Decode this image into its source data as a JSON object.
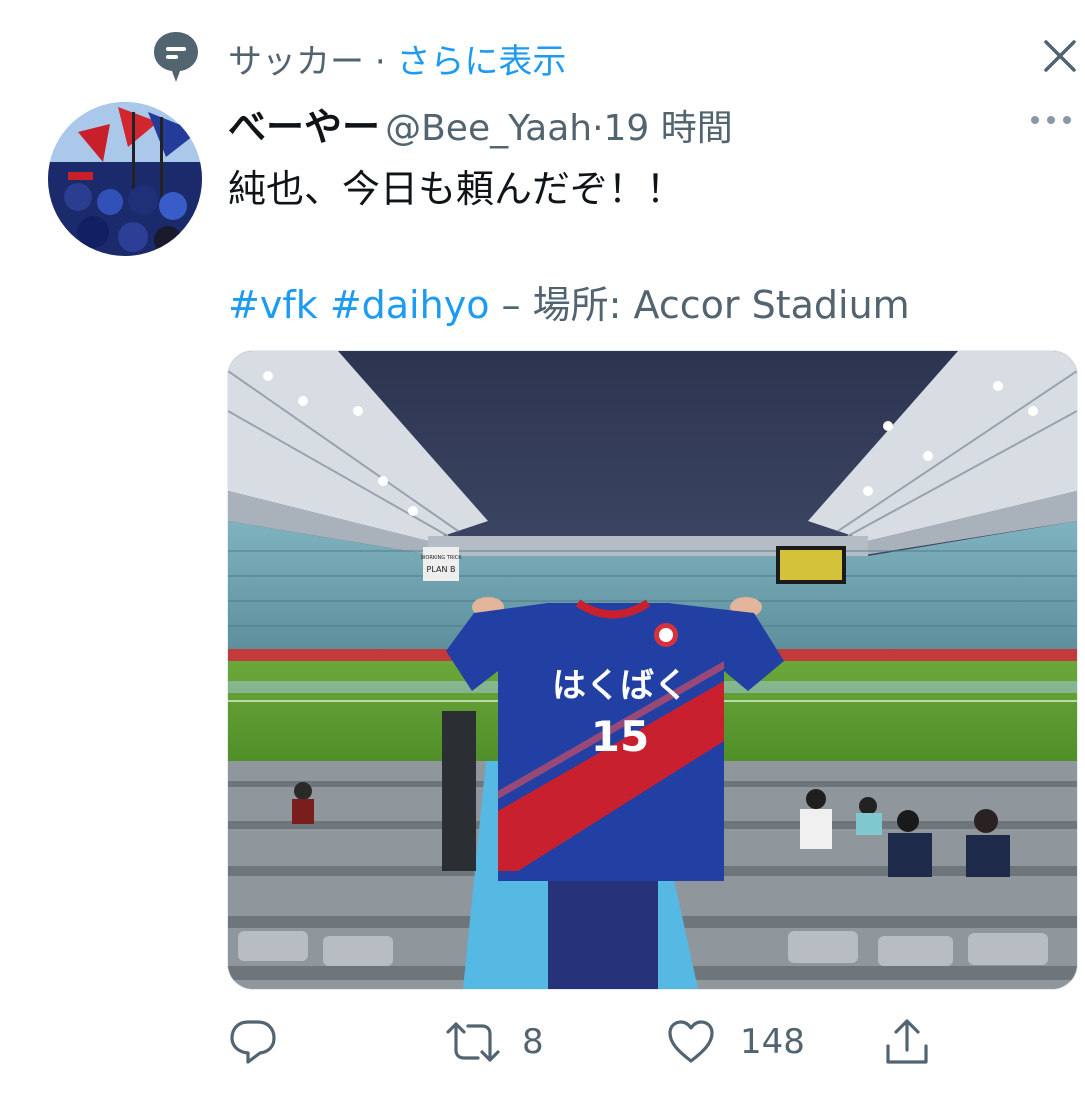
{
  "topic": {
    "label": "サッカー",
    "separator": "·",
    "show_more": "さらに表示"
  },
  "author": {
    "name": "べーやー",
    "handle": "@Bee_Yaah",
    "dot": "·",
    "time": "19 時間"
  },
  "tweet": {
    "text": "純也、今日も頼んだぞ！！",
    "hashtags": [
      "#vfk",
      "#daihyo"
    ],
    "location_prefix": "– 場所: ",
    "location": "Accor Stadium"
  },
  "media": {
    "jersey_name": "はくばく",
    "jersey_number": "15",
    "sign_text": [
      "WORKING TRICK",
      "PLAN B"
    ]
  },
  "actions": {
    "replies": "",
    "retweets": "8",
    "likes": "148"
  },
  "colors": {
    "accent": "#1d9bf0",
    "secondary_text": "#536471",
    "primary_text": "#0f1419"
  }
}
